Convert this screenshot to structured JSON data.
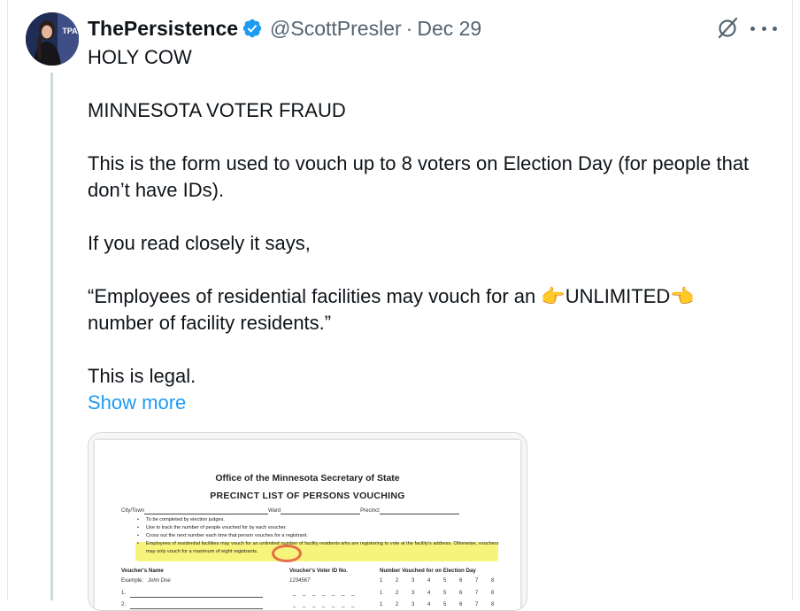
{
  "tweet": {
    "display_name": "ThePersistence",
    "verified": true,
    "handle": "@ScottPresler",
    "separator": "·",
    "date": "Dec 29",
    "paragraphs": [
      "HOLY COW",
      "MINNESOTA VOTER FRAUD",
      "This is the form used to vouch up to 8 voters on Election Day (for people that don’t have IDs).",
      "If you read closely it says,",
      "“Employees of residential facilities may vouch for an 👉UNLIMITED👈 number of facility residents.”",
      "This is legal."
    ],
    "show_more_label": "Show more",
    "icons": {
      "avatar": "avatar-photo",
      "verified": "verified-badge-icon",
      "grok": "grok-icon",
      "more": "more-icon"
    },
    "colors": {
      "link": "#1d9bf0",
      "secondary_text": "#536471",
      "verified": "#1d9bf0"
    }
  },
  "media": {
    "doc_title": "Office of the Minnesota Secretary of State",
    "doc_subtitle": "PRECINCT LIST OF PERSONS VOUCHING",
    "context_fields": [
      "City/Town",
      "Ward",
      "Precinct"
    ],
    "bullets": [
      "To be completed by election judges.",
      "Use to track the number of people vouched for by each voucher.",
      "Cross out the next number each time that person vouches for a registrant.",
      "Employees of residential facilities may vouch for an unlimited number of facility residents who are registering to vote at the facility's address. Otherwise, vouchers may only vouch for a maximum of eight registrants."
    ],
    "columns": [
      "Voucher's Name",
      "Voucher's Voter ID No.",
      "Number Vouched for on Election Day"
    ],
    "example_label": "Example:",
    "example_name": "John Doe",
    "example_id": "1234567",
    "count_sequence": "1 2 3 4 5 6 7 8",
    "row_numbers": [
      "1.",
      "2."
    ],
    "blank_id": "_ _ _ _ _ _ _"
  }
}
